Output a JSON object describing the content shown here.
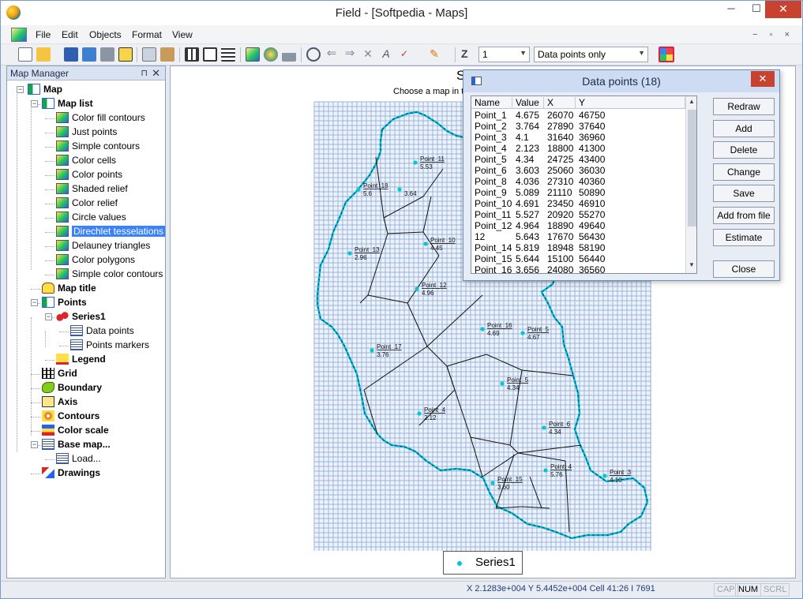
{
  "window": {
    "title": "Field - [Softpedia - Maps]",
    "controls": {
      "minimize": "─",
      "maximize": "☐",
      "close": "✕"
    }
  },
  "menu": {
    "items": [
      "File",
      "Edit",
      "Objects",
      "Format",
      "View"
    ],
    "mdi_controls": "− ▫ ×"
  },
  "toolbar": {
    "zoom_label": "Z",
    "zoom_value": "1",
    "display_mode": "Data points only",
    "icons": [
      "new-icon",
      "open-icon",
      "save-icon",
      "save-all-icon",
      "print-icon",
      "preview-icon",
      "copy-icon",
      "paste-icon",
      "grid-icon",
      "layout-icon",
      "list-icon",
      "map-icon",
      "3d-icon",
      "chart-icon",
      "zoom-in-icon",
      "arrow-left-icon",
      "arrow-right-icon",
      "tool-icon",
      "axis-icon",
      "draw-icon",
      "pen-icon",
      "color-icon"
    ]
  },
  "map_manager": {
    "title": "Map Manager",
    "pin": "⊓",
    "close": "✕",
    "tree": [
      {
        "label": "Map",
        "bold": true
      },
      {
        "label": "Map list",
        "bold": true
      },
      {
        "label": "Color fill contours",
        "bold": false
      },
      {
        "label": "Just points",
        "bold": false
      },
      {
        "label": "Simple contours",
        "bold": false
      },
      {
        "label": "Color cells",
        "bold": false
      },
      {
        "label": "Color points",
        "bold": false
      },
      {
        "label": "Shaded relief",
        "bold": false
      },
      {
        "label": "Color relief",
        "bold": false
      },
      {
        "label": "Circle values",
        "bold": false
      },
      {
        "label": "Direchlet tesselations",
        "bold": false,
        "selected": true
      },
      {
        "label": "Delauney triangles",
        "bold": false
      },
      {
        "label": "Color polygons",
        "bold": false
      },
      {
        "label": "Simple color contours",
        "bold": false
      },
      {
        "label": "Map title",
        "bold": true
      },
      {
        "label": "Points",
        "bold": true
      },
      {
        "label": "Series1",
        "bold": true
      },
      {
        "label": "Data points",
        "bold": false
      },
      {
        "label": "Points markers",
        "bold": false
      },
      {
        "label": "Legend",
        "bold": true
      },
      {
        "label": "Grid",
        "bold": true
      },
      {
        "label": "Boundary",
        "bold": true
      },
      {
        "label": "Axis",
        "bold": true
      },
      {
        "label": "Contours",
        "bold": true
      },
      {
        "label": "Color scale",
        "bold": true
      },
      {
        "label": "Base map...",
        "bold": true
      },
      {
        "label": "Load...",
        "bold": false
      },
      {
        "label": "Drawings",
        "bold": true
      }
    ]
  },
  "map": {
    "title": "S",
    "subtitle": "Choose a map in th",
    "legend_label": "Series1",
    "point_labels": [
      {
        "name": "Point_11",
        "value": "5.53"
      },
      {
        "name": "Point_18",
        "value": "5.6"
      },
      {
        "name": "",
        "value": "3.64"
      },
      {
        "name": "Point_13",
        "value": "2.96"
      },
      {
        "name": "Point_10",
        "value": "4.45"
      },
      {
        "name": "Point_12",
        "value": "4.96"
      },
      {
        "name": "Point_16",
        "value": "4.69"
      },
      {
        "name": "Point_5",
        "value": "4.67"
      },
      {
        "name": "Point_17",
        "value": "3.76"
      },
      {
        "name": "Point_5",
        "value": "4.34"
      },
      {
        "name": "Point_4",
        "value": "2.12"
      },
      {
        "name": "Point_6",
        "value": "4.34"
      },
      {
        "name": "Point_4",
        "value": "5.76"
      },
      {
        "name": "Point_3",
        "value": "4.10"
      },
      {
        "name": "Point_15",
        "value": "3.60"
      }
    ]
  },
  "dialog": {
    "title": "Data points (18)",
    "close": "✕",
    "columns": [
      "Name",
      "Value",
      "X",
      "Y"
    ],
    "rows": [
      [
        "Point_1",
        "4.675",
        "26070",
        "46750"
      ],
      [
        "Point_2",
        "3.764",
        "27890",
        "37640"
      ],
      [
        "Point_3",
        "4.1",
        "31640",
        "36960"
      ],
      [
        "Point_4",
        "2.123",
        "18800",
        "41300"
      ],
      [
        "Point_5",
        "4.34",
        "24725",
        "43400"
      ],
      [
        "Point_6",
        "3.603",
        "25060",
        "36030"
      ],
      [
        "Point_8",
        "4.036",
        "27310",
        "40360"
      ],
      [
        "Point_9",
        "5.089",
        "21110",
        "50890"
      ],
      [
        "Point_10",
        "4.691",
        "23450",
        "46910"
      ],
      [
        "Point_11",
        "5.527",
        "20920",
        "55270"
      ],
      [
        "Point_12",
        "4.964",
        "18890",
        "49640"
      ],
      [
        "12",
        "5.643",
        "17670",
        "56430"
      ],
      [
        "Point_14",
        "5.819",
        "18948",
        "58190"
      ],
      [
        "Point_15",
        "5.644",
        "15100",
        "56440"
      ],
      [
        "Point_16",
        "3.656",
        "24080",
        "36560"
      ]
    ],
    "buttons": [
      "Redraw",
      "Add",
      "Delete",
      "Change",
      "Save",
      "Add from file",
      "Estimate",
      "Close"
    ]
  },
  "status": {
    "coords": "X 2.1283e+004 Y 5.4452e+004 Cell 41:26 I 7691",
    "cap": "CAP",
    "num": "NUM",
    "scrl": "SCRL"
  },
  "colors": {
    "boundary": "#00bcd4",
    "grid": "#9ab4d8",
    "point": "#00c8d6",
    "selection": "#3b82f6"
  }
}
